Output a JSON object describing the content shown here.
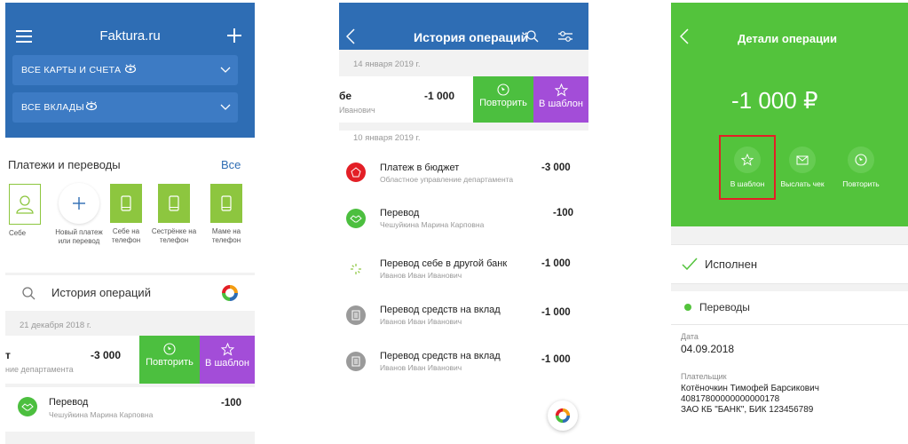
{
  "screen1": {
    "app_title": "Faktura.ru",
    "accounts_label": "ВСЕ КАРТЫ И СЧЕТА",
    "deposits_label": "ВСЕ ВКЛАДЫ",
    "payments_title": "Платежи и переводы",
    "payments_all": "Все",
    "tiles": [
      {
        "label": "Себе"
      },
      {
        "label": "Новый платеж или перевод"
      },
      {
        "label": "Себе на телефон"
      },
      {
        "label": "Сестрёнке на телефон"
      },
      {
        "label": "Маме на телефон"
      }
    ],
    "history_label": "История операций",
    "date": "21 декабря 2018 г.",
    "swiped": {
      "title": "т",
      "amount": "-3 000",
      "sub": "ние департамента",
      "repeat": "Повторить",
      "template": "В шаблон"
    },
    "op": {
      "title": "Перевод",
      "sub": "Чешуйкина Марина Карповна",
      "amount": "-100"
    }
  },
  "screen2": {
    "title": "История операций",
    "date1": "14 января 2019 г.",
    "swiped": {
      "title": "бе",
      "amount": "-1 000",
      "sub": "Иванович",
      "repeat": "Повторить",
      "template": "В шаблон"
    },
    "date2": "10 января 2019 г.",
    "ops": [
      {
        "title": "Платеж в бюджет",
        "sub": "Областное управление департамента",
        "amount": "-3 000"
      },
      {
        "title": "Перевод",
        "sub": "Чешуйкина Марина Карповна",
        "amount": "-100"
      },
      {
        "title": "Перевод себе в другой банк",
        "sub": "Иванов Иван Иванович",
        "amount": "-1 000"
      },
      {
        "title": "Перевод средств на вклад",
        "sub": "Иванов Иван Иванович",
        "amount": "-1 000"
      },
      {
        "title": "Перевод средств на вклад",
        "sub": "Иванов Иван Иванович",
        "amount": "-1 000"
      }
    ]
  },
  "screen3": {
    "title": "Детали операции",
    "amount": "-1 000 ₽",
    "actions": [
      {
        "label": "В шаблон"
      },
      {
        "label": "Выслать чек"
      },
      {
        "label": "Повторить"
      }
    ],
    "status": "Исполнен",
    "category": "Переводы",
    "date_label": "Дата",
    "date_value": "04.09.2018",
    "payer_label": "Плательщик",
    "payer_name": "Котёночкин Тимофей Барсикович",
    "payer_account": "40817800000000000178",
    "payer_bank": "ЗАО КБ \"БАНК\", БИК 123456789"
  },
  "colors": {
    "blue_header": "#2e6db4",
    "green": "#4cbf3f",
    "purple": "#a34dd8",
    "tile_green": "#8dc63f",
    "detail_green": "#53c33c",
    "highlight_red": "#e31f26"
  },
  "icons": [
    "menu-icon",
    "plus-icon",
    "eye-icon",
    "chevron-down-icon",
    "person-icon",
    "phone-icon",
    "search-icon",
    "donut-chart-icon",
    "repeat-icon",
    "star-icon",
    "back-icon",
    "filter-icon",
    "envelope-icon",
    "check-icon",
    "handshake-icon",
    "budget-icon",
    "loading-icon",
    "document-icon",
    "app-logo-icon"
  ]
}
